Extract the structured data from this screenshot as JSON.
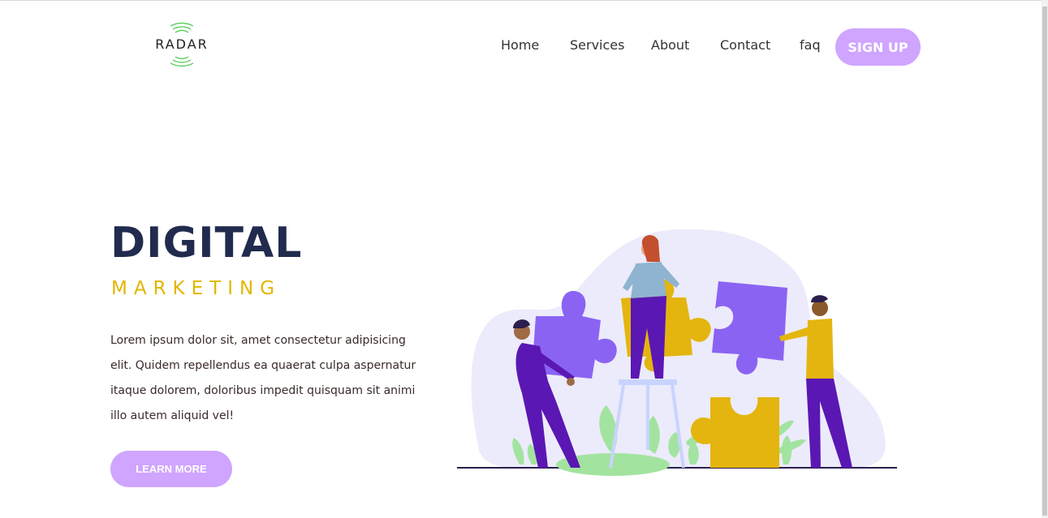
{
  "brand": {
    "logo_text": "RADAR"
  },
  "nav": {
    "items": [
      "Home",
      "Services",
      "About",
      "Contact",
      "faq"
    ],
    "signup_label": "SIGN UP"
  },
  "hero": {
    "title": "DIGITAL",
    "subtitle": "MARKETING",
    "description": "Lorem ipsum dolor sit, amet consectetur adipisicing elit. Quidem repellendus ea quaerat culpa aspernatur itaque dolorem, doloribus impedit quisquam sit animi illo autem aliquid vel!",
    "cta_label": "LEARN MORE"
  },
  "illustration": {
    "subject": "people assembling puzzle pieces"
  },
  "colors": {
    "accent": "#cfa5ff",
    "title": "#212b4e",
    "subtitle": "#e2b600",
    "puzzle_purple": "#8b63f2",
    "puzzle_yellow": "#e4b50e",
    "leaf_green": "#a3e3a0"
  }
}
